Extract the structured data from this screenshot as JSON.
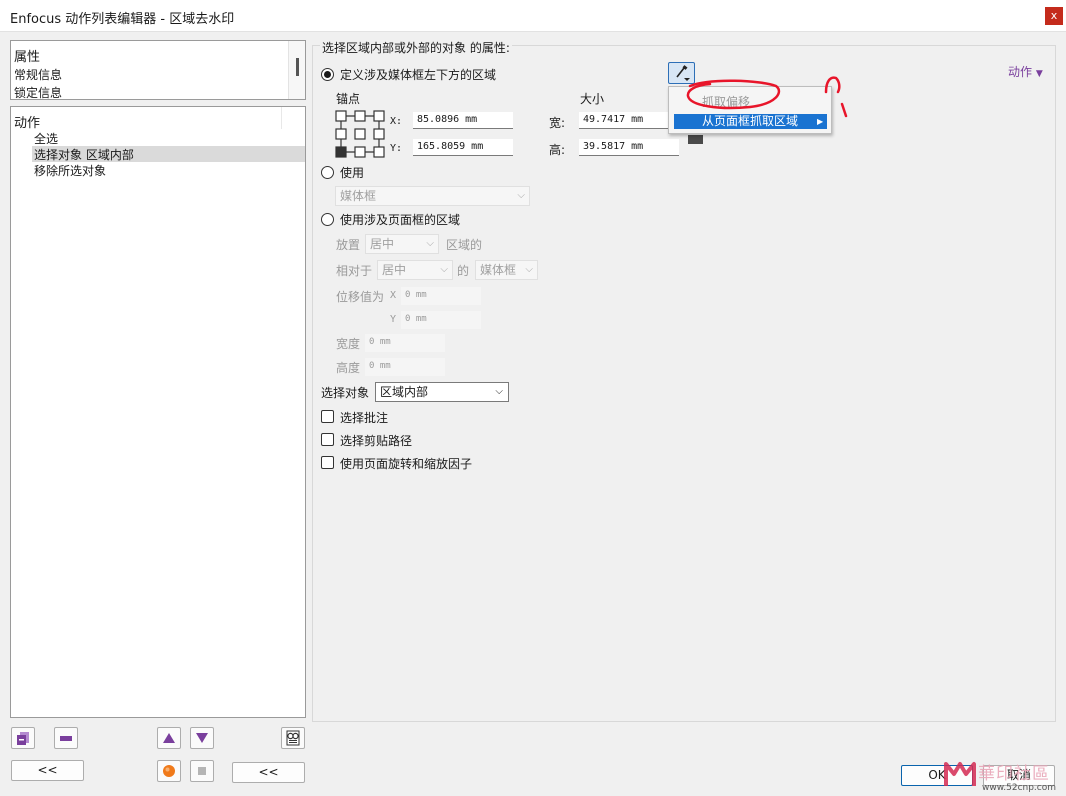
{
  "window": {
    "title": "Enfocus 动作列表编辑器 - 区域去水印",
    "close_label": "x"
  },
  "sidebar": {
    "props_items": [
      "属性",
      "常规信息",
      "锁定信息"
    ],
    "actions_items": [
      "动作",
      "全选",
      "选择对象 区域内部",
      "移除所选对象"
    ],
    "collapse_label": "<<",
    "collapse2_label": "<<"
  },
  "main": {
    "group_title": "选择区域内部或外部的对象 的属性:",
    "actions_link": "动作",
    "radio1_label": "定义涉及媒体框左下方的区域",
    "anchor_label": "锚点",
    "size_label": "大小",
    "x_label": "X:",
    "y_label": "Y:",
    "x_value": "85.0896 mm",
    "y_value": "165.8059 mm",
    "width_label": "宽:",
    "height_label": "高:",
    "width_value": "49.7417 mm",
    "height_value": "39.5817 mm",
    "radio2_label": "使用",
    "box_select": "媒体框",
    "radio3_label": "使用涉及页面框的区域",
    "place_label": "放置",
    "place_value": "居中",
    "region_of_label": "区域的",
    "relative_label": "相对于",
    "relative_value": "居中",
    "of_label": "的",
    "of_value": "媒体框",
    "offset_label": "位移值为",
    "offset_x_label": "X",
    "offset_x_value": "0 mm",
    "offset_y_label": "Y",
    "offset_y_value": "0 mm",
    "w2_label": "宽度",
    "w2_value": "0 mm",
    "h2_label": "高度",
    "h2_value": "0 mm",
    "select_label": "选择对象",
    "select_value": "区域内部",
    "cb1_label": "选择批注",
    "cb2_label": "选择剪贴路径",
    "cb3_label": "使用页面旋转和缩放因子"
  },
  "menu": {
    "item1": "抓取偏移",
    "item2": "从页面框抓取区域"
  },
  "footer": {
    "ok_label": "OK",
    "cancel_label": "取消",
    "watermark_text": "華印社區",
    "watermark_url": "www.52cnp.com"
  },
  "colors": {
    "accent": "#1a73d1",
    "purple": "#7a3f9d",
    "annotation_red": "#e8152a"
  }
}
